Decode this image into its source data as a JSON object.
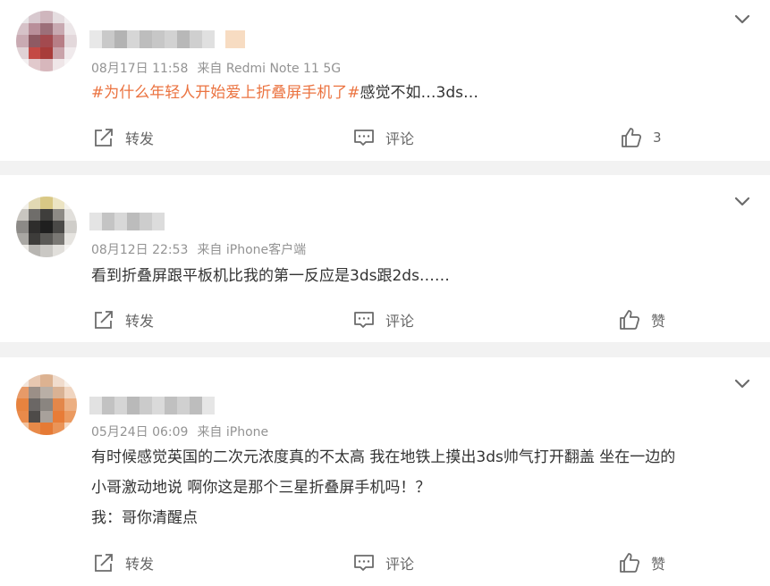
{
  "comments": [
    {
      "meta_time": "08月17日 11:58",
      "meta_source": "来自 Redmi Note 11 5G",
      "content_tag": "#为什么年轻人开始爱上折叠屏手机了#",
      "content_text": "感觉不如…3ds…",
      "repost_label": "转发",
      "comment_label": "评论",
      "like_label": "3"
    },
    {
      "meta_time": "08月12日 22:53",
      "meta_source": "来自 iPhone客户端",
      "content_text": "看到折叠屏跟平板机比我的第一反应是3ds跟2ds……",
      "repost_label": "转发",
      "comment_label": "评论",
      "like_label": "赞"
    },
    {
      "meta_time": "05月24日 06:09",
      "meta_source": "来自 iPhone",
      "content_lines": [
        "有时候感觉英国的二次元浓度真的不太高 我在地铁上摸出3ds帅气打开翻盖 坐在一边的",
        "小哥激动地说 啊你这是那个三星折叠屏手机吗！？",
        "我：哥你清醒点"
      ],
      "repost_label": "转发",
      "comment_label": "评论",
      "like_label": "赞"
    }
  ],
  "icons": {
    "repost": "repost-icon",
    "comment": "comment-icon",
    "like": "thumbs-up-icon",
    "more": "chevron-down-icon"
  },
  "colors": {
    "topic_tag": "#eb7340",
    "meta_text": "#939393",
    "body_text": "#333333",
    "icon": "#6b6b6b",
    "separator": "#f2f2f2"
  }
}
